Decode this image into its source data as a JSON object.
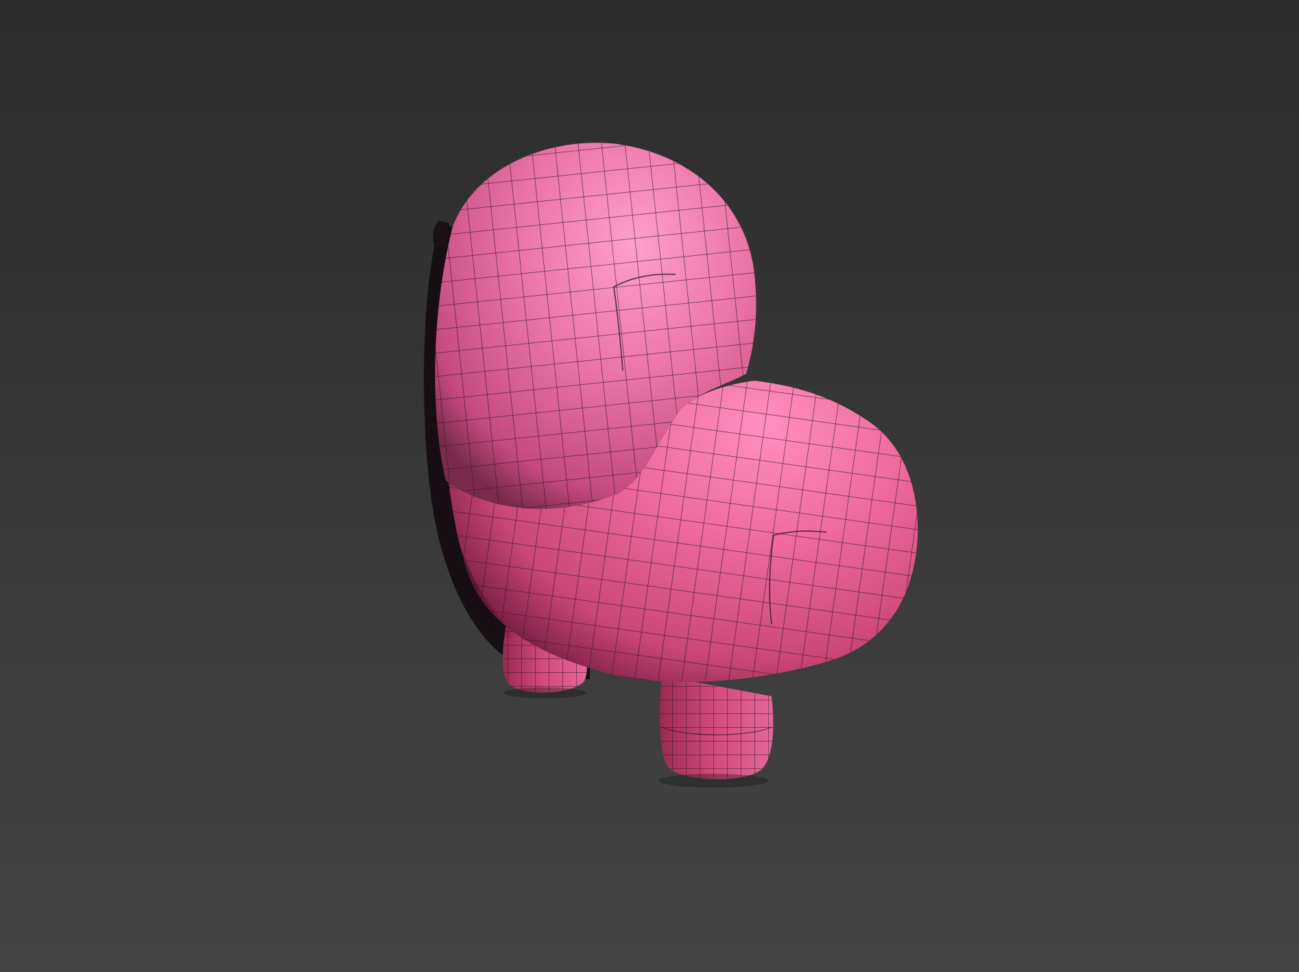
{
  "viewport": {
    "label": "",
    "background_top": "#2c2c2c",
    "background_bottom": "#444444"
  },
  "model": {
    "object": "character-body-mesh",
    "display_mode": "shaded-with-wireframe",
    "surface_color": "#e85c94",
    "highlight_color": "#ff9fcb",
    "shadow_color": "#7a1f44",
    "wire_color": "#2a1520"
  }
}
